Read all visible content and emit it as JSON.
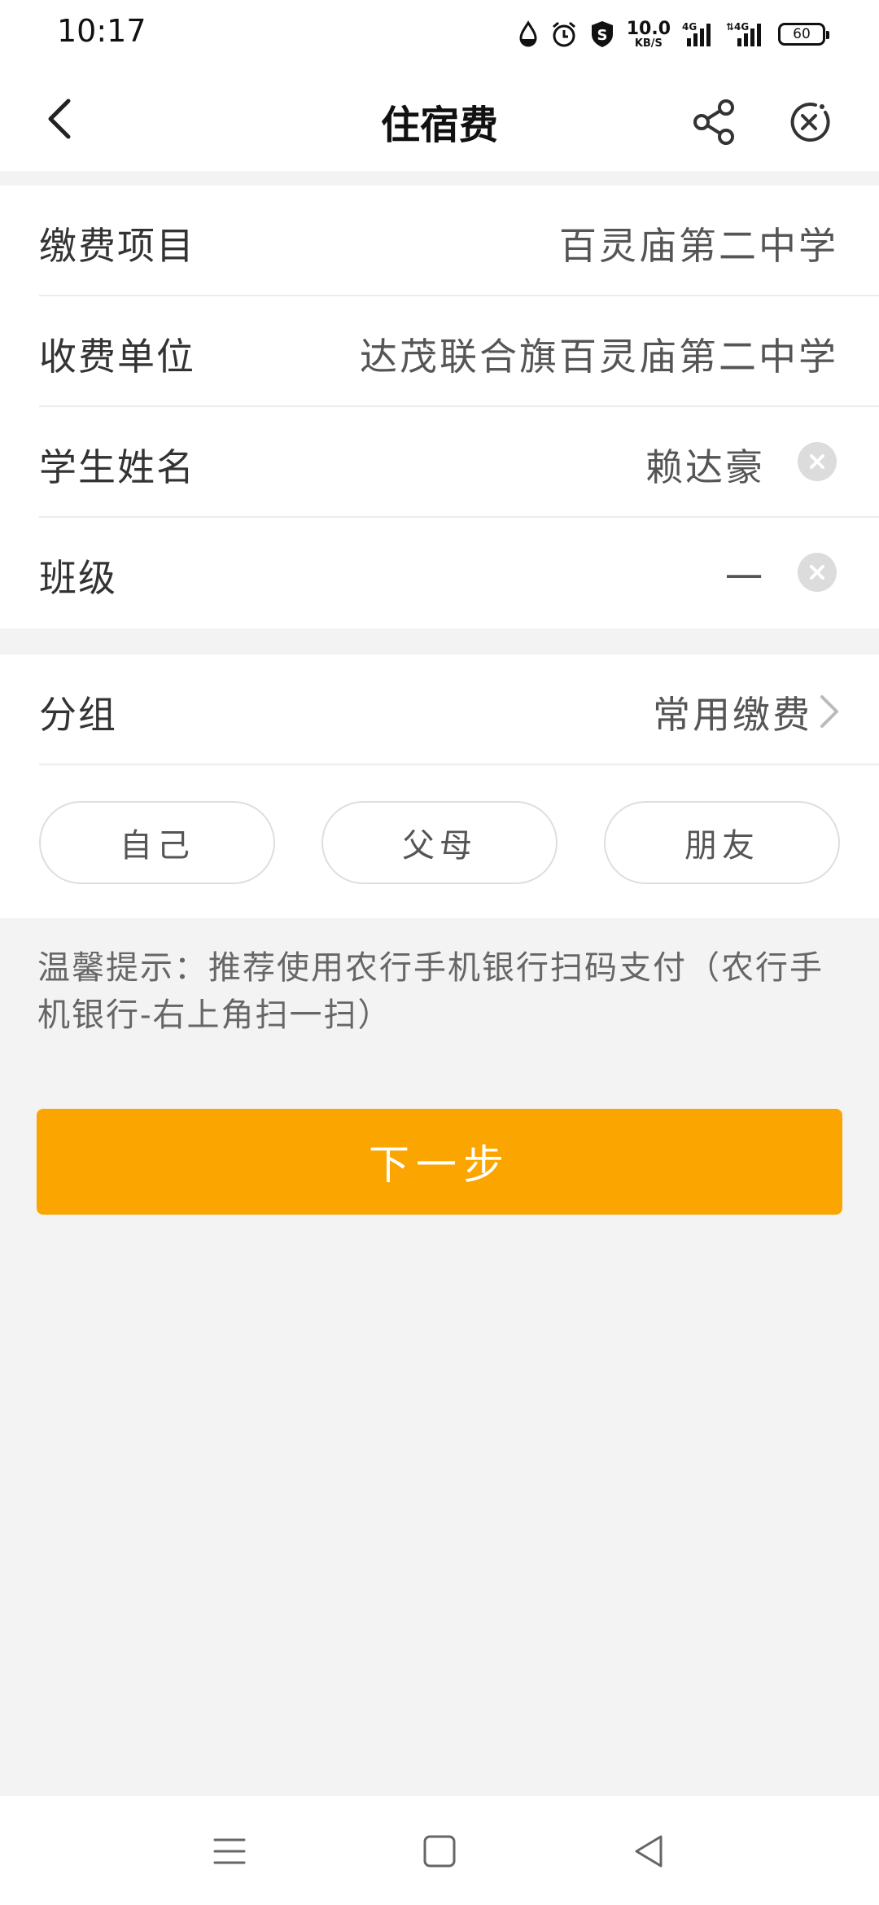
{
  "status_bar": {
    "time": "10:17",
    "speed_value": "10.0",
    "speed_unit": "KB/S",
    "battery": "60",
    "signal1": "4G",
    "signal2": "4G"
  },
  "header": {
    "title": "住宿费",
    "back_icon": "chevron-left-icon",
    "share_icon": "share-icon",
    "close_icon": "close-circle-icon"
  },
  "form": {
    "rows": [
      {
        "label": "缴费项目",
        "value": "百灵庙第二中学"
      },
      {
        "label": "收费单位",
        "value": "达茂联合旗百灵庙第二中学"
      },
      {
        "label": "学生姓名",
        "value": "赖达豪"
      },
      {
        "label": "班级",
        "value": "一"
      }
    ]
  },
  "group": {
    "label": "分组",
    "value": "常用缴费",
    "options": [
      "自己",
      "父母",
      "朋友"
    ]
  },
  "tip": "温馨提示：推荐使用农行手机银行扫码支付（农行手机银行-右上角扫一扫）",
  "next_button": "下一步",
  "colors": {
    "accent": "#fba600",
    "background": "#f3f3f3",
    "card": "#ffffff"
  }
}
